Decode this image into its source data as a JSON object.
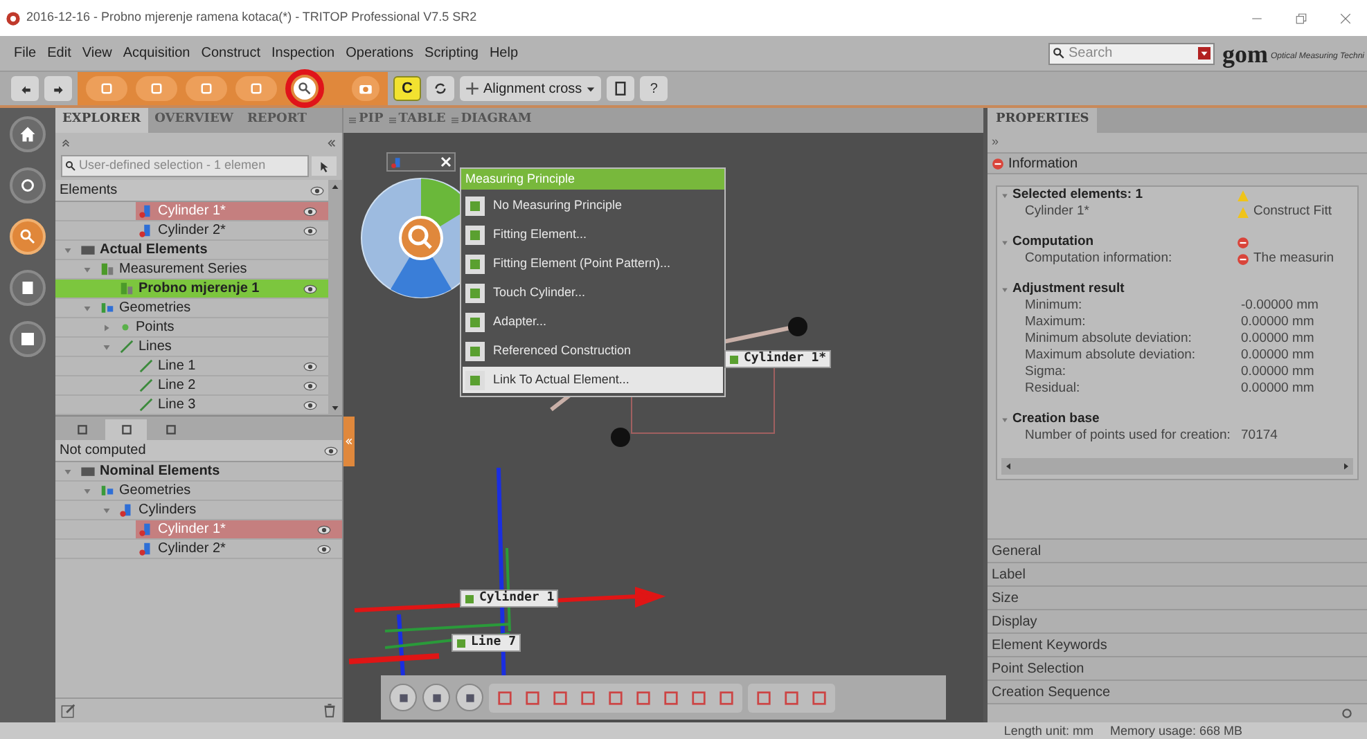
{
  "window": {
    "title": "2016-12-16 - Probno mjerenje ramena kotaca(*) - TRITOP Professional V7.5 SR2"
  },
  "menu": [
    "File",
    "Edit",
    "View",
    "Acquisition",
    "Construct",
    "Inspection",
    "Operations",
    "Scripting",
    "Help"
  ],
  "search": {
    "placeholder": "Search"
  },
  "logo": {
    "text": "gom",
    "tagline": "Optical Measuring Techni"
  },
  "toolbar": {
    "compute_label": "C",
    "alignment": "Alignment cross",
    "help": "?"
  },
  "explorer": {
    "tabs": [
      {
        "label": "EXPLORER",
        "selected": true
      },
      {
        "label": "OVERVIEW",
        "selected": false
      },
      {
        "label": "REPORT",
        "selected": false
      }
    ],
    "filter": "User-defined selection - 1 elemen",
    "header": "Elements",
    "tree_continued": [
      {
        "label": "Cylinder 1*",
        "kind": "cylinder",
        "selected": true,
        "active": false,
        "bold": false,
        "visible": true
      },
      {
        "label": "Cylinder 2*",
        "kind": "cylinder",
        "selected": false,
        "active": false,
        "bold": false,
        "visible": true
      }
    ],
    "tree": [
      {
        "label": "Actual Elements",
        "kind": "folder",
        "selected": false,
        "active": false,
        "bold": true,
        "visible": false,
        "expanded": true,
        "children": [
          {
            "label": "Measurement Series",
            "kind": "series",
            "selected": false,
            "active": false,
            "bold": false,
            "visible": false,
            "expanded": true,
            "children": [
              {
                "label": "Probno mjerenje 1",
                "kind": "series",
                "selected": false,
                "active": true,
                "bold": true,
                "visible": true
              }
            ]
          },
          {
            "label": "Geometries",
            "kind": "geometry",
            "selected": false,
            "active": false,
            "bold": false,
            "visible": false,
            "expanded": true,
            "children": [
              {
                "label": "Points",
                "kind": "point",
                "selected": false,
                "active": false,
                "bold": false,
                "visible": false,
                "expanded": false
              },
              {
                "label": "Lines",
                "kind": "line",
                "selected": false,
                "active": false,
                "bold": false,
                "visible": false,
                "expanded": true,
                "children": [
                  {
                    "label": "Line 1",
                    "kind": "line",
                    "selected": false,
                    "active": false,
                    "bold": false,
                    "visible": true
                  },
                  {
                    "label": "Line 2",
                    "kind": "line",
                    "selected": false,
                    "active": false,
                    "bold": false,
                    "visible": true
                  },
                  {
                    "label": "Line 3",
                    "kind": "line",
                    "selected": false,
                    "active": false,
                    "bold": false,
                    "visible": true
                  }
                ]
              }
            ]
          }
        ]
      }
    ],
    "tool_tabs": [
      {
        "selected": false
      },
      {
        "selected": true
      },
      {
        "selected": false
      }
    ],
    "nominal_header": "Not computed",
    "nominal_tree": [
      {
        "label": "Nominal Elements",
        "kind": "folder",
        "selected": false,
        "active": false,
        "bold": true,
        "visible": false,
        "expanded": true,
        "children": [
          {
            "label": "Geometries",
            "kind": "geometry",
            "selected": false,
            "active": false,
            "bold": false,
            "visible": false,
            "expanded": true,
            "children": [
              {
                "label": "Cylinders",
                "kind": "cylinder",
                "selected": false,
                "active": false,
                "bold": false,
                "visible": false,
                "expanded": true,
                "children": [
                  {
                    "label": "Cylinder 1*",
                    "kind": "cylinder",
                    "selected": true,
                    "active": false,
                    "bold": false,
                    "visible": true
                  },
                  {
                    "label": "Cylinder 2*",
                    "kind": "cylinder",
                    "selected": false,
                    "active": false,
                    "bold": false,
                    "visible": true
                  }
                ]
              }
            ]
          }
        ]
      }
    ]
  },
  "view_tabs": [
    "PIP",
    "TABLE",
    "DIAGRAM"
  ],
  "measuring_menu": {
    "title": "Measuring Principle",
    "items": [
      {
        "label": "No Measuring Principle",
        "selected": false
      },
      {
        "label": "Fitting Element...",
        "selected": false
      },
      {
        "label": "Fitting Element (Point Pattern)...",
        "selected": false
      },
      {
        "label": "Touch Cylinder...",
        "selected": false
      },
      {
        "label": "Adapter...",
        "selected": false
      },
      {
        "label": "Referenced Construction",
        "selected": false
      },
      {
        "label": "Link To Actual Element...",
        "selected": true
      }
    ]
  },
  "scene_labels": [
    "Cylinder 1*",
    "Cylinder 1",
    "Line 7"
  ],
  "properties": {
    "tab": "PROPERTIES",
    "collapse": "»",
    "section": "Information",
    "groups": [
      {
        "title": "Selected elements: 1",
        "kind": "warning",
        "rows": [
          {
            "label": "Cylinder 1*",
            "value": "Construct Fitt",
            "kind": "warning"
          }
        ]
      },
      {
        "title": "Computation",
        "kind": "error",
        "rows": [
          {
            "label": "Computation information:",
            "value": "The measurin",
            "kind": "error"
          }
        ]
      },
      {
        "title": "Adjustment result",
        "kind": "plain",
        "rows": [
          {
            "label": "Minimum:",
            "value": "-0.00000 mm",
            "kind": "plain"
          },
          {
            "label": "Maximum:",
            "value": "0.00000 mm",
            "kind": "plain"
          },
          {
            "label": "Minimum absolute deviation:",
            "value": "0.00000 mm",
            "kind": "plain"
          },
          {
            "label": "Maximum absolute deviation:",
            "value": "0.00000 mm",
            "kind": "plain"
          },
          {
            "label": "Sigma:",
            "value": "0.00000 mm",
            "kind": "plain"
          },
          {
            "label": "Residual:",
            "value": "0.00000 mm",
            "kind": "plain"
          }
        ]
      },
      {
        "title": "Creation base",
        "kind": "plain",
        "rows": [
          {
            "label": "Number of points used for creation:",
            "value": "70174",
            "kind": "plain"
          }
        ]
      }
    ],
    "sections": [
      "General",
      "Label",
      "Size",
      "Display",
      "Element Keywords",
      "Point Selection",
      "Creation Sequence"
    ]
  },
  "status_bar": [
    "Length unit: mm",
    "Memory usage: 668 MB"
  ]
}
